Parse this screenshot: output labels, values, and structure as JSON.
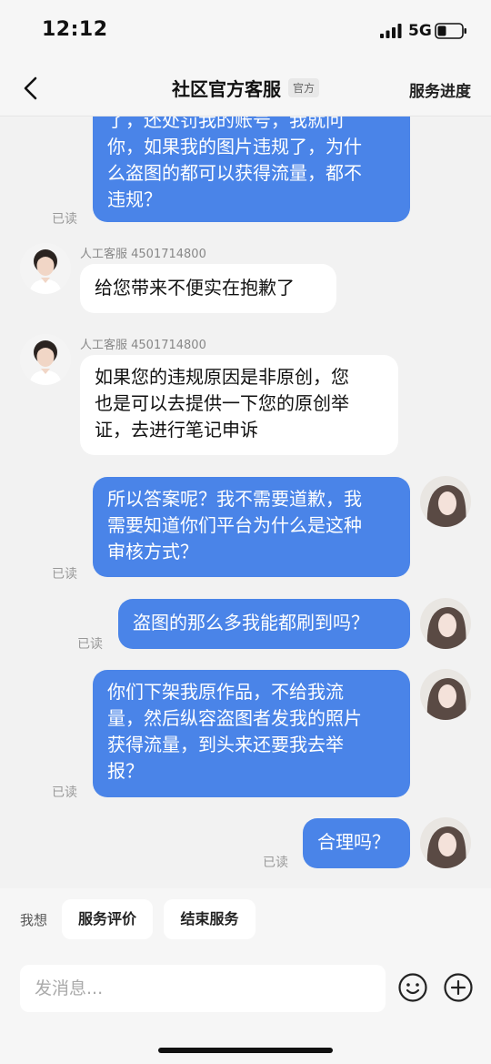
{
  "status_bar": {
    "time": "12:12",
    "network": "5G"
  },
  "nav": {
    "title": "社区官方客服",
    "tag": "官方",
    "progress_label": "服务进度"
  },
  "messages": [
    {
      "lines": [
        "了，还处罚我的账号，我就问",
        "你，如果我的图片违规了，为什",
        "么盗图的都可以获得流量，都不",
        "违规？"
      ],
      "read": "已读"
    },
    {
      "sender": "人工客服 4501714800",
      "lines": [
        "给您带来不便实在抱歉了"
      ]
    },
    {
      "sender": "人工客服 4501714800",
      "lines": [
        "如果您的违规原因是非原创，您",
        "也是可以去提供一下您的原创举",
        "证，去进行笔记申诉"
      ]
    },
    {
      "lines": [
        "所以答案呢？我不需要道歉，我",
        "需要知道你们平台为什么是这种",
        "审核方式？"
      ],
      "read": "已读"
    },
    {
      "lines": [
        "盗图的那么多我能都刷到吗？"
      ],
      "read": "已读"
    },
    {
      "lines": [
        "你们下架我原作品，不给我流",
        "量，然后纵容盗图者发我的照片",
        "获得流量，到头来还要我去举",
        "报？"
      ],
      "read": "已读"
    },
    {
      "lines": [
        "合理吗？"
      ],
      "read": "已读"
    }
  ],
  "quick_actions": {
    "label": "我想",
    "items": [
      "服务评价",
      "结束服务"
    ]
  },
  "composer": {
    "placeholder": "发消息..."
  },
  "colors": {
    "my_bubble": "#4a84e8",
    "their_bubble": "#ffffff",
    "background": "#f2f2f2"
  }
}
